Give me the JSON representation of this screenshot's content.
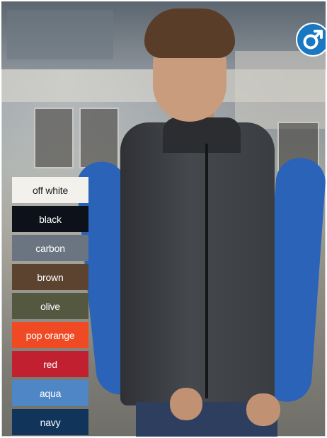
{
  "badge": {
    "icon": "male-symbol-icon",
    "color": "#1a78c2"
  },
  "swatches": [
    {
      "label": "off white",
      "color": "#f3f1ec",
      "text_color": "#222222"
    },
    {
      "label": "black",
      "color": "#0d1119",
      "text_color": "#ffffff"
    },
    {
      "label": "carbon",
      "color": "#6b7582",
      "text_color": "#ffffff"
    },
    {
      "label": "brown",
      "color": "#5b4330",
      "text_color": "#ffffff"
    },
    {
      "label": "olive",
      "color": "#545841",
      "text_color": "#ffffff"
    },
    {
      "label": "pop orange",
      "color": "#ef4a24",
      "text_color": "#ffffff"
    },
    {
      "label": "red",
      "color": "#c0202f",
      "text_color": "#ffffff"
    },
    {
      "label": "aqua",
      "color": "#4f86c6",
      "text_color": "#ffffff"
    },
    {
      "label": "navy",
      "color": "#10345a",
      "text_color": "#ffffff"
    }
  ]
}
